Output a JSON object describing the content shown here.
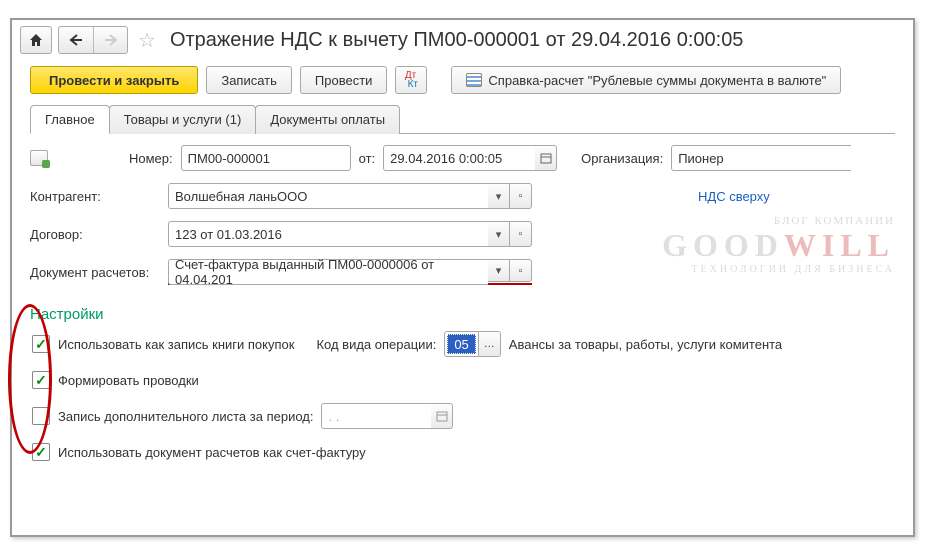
{
  "header": {
    "title": "Отражение НДС к вычету ПМ00-000001 от 29.04.2016 0:00:05"
  },
  "toolbar": {
    "post_close": "Провести и закрыть",
    "save": "Записать",
    "post": "Провести",
    "report": "Справка-расчет \"Рублевые суммы документа в валюте\""
  },
  "tabs": {
    "main": "Главное",
    "items": "Товары и услуги (1)",
    "payments": "Документы оплаты"
  },
  "form": {
    "number_label": "Номер:",
    "number": "ПМ00-000001",
    "from_label": "от:",
    "date": "29.04.2016  0:00:05",
    "org_label": "Организация:",
    "org": "Пионер",
    "counterparty_label": "Контрагент:",
    "counterparty": "Волшебная ланьООО",
    "vat_link": "НДС сверху",
    "contract_label": "Договор:",
    "contract": "123 от 01.03.2016",
    "docsettle_label": "Документ расчетов:",
    "docsettle": "Счет-фактура выданный ПМ00-0000006 от 04.04.201"
  },
  "settings": {
    "title": "Настройки",
    "opt1": "Использовать как запись книги покупок",
    "opt2": "Формировать проводки",
    "opt3": "Запись дополнительного листа за период:",
    "opt3_date": ". .",
    "opt4": "Использовать документ расчетов как счет-фактуру",
    "opcode_label": "Код вида операции:",
    "opcode": "05",
    "opcode_desc": "Авансы за товары, работы, услуги комитента"
  },
  "watermark": {
    "line1": "БЛОГ КОМПАНИИ",
    "big1": "GOOD",
    "big2": "WILL",
    "line2": "ТЕХНОЛОГИИ ДЛЯ БИЗНЕСА"
  }
}
